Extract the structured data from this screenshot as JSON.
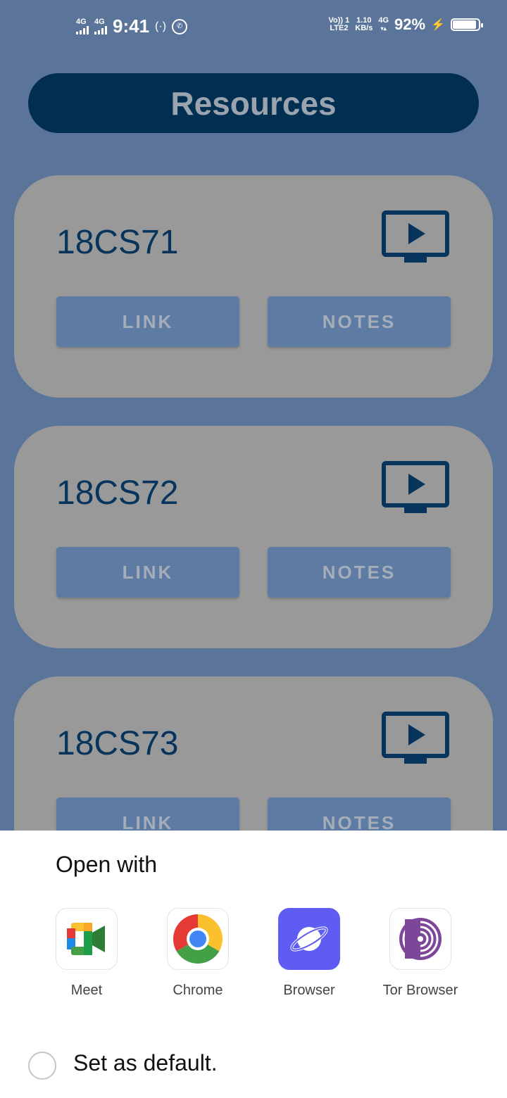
{
  "status_bar": {
    "sim1_label": "4G",
    "sim2_label": "4G",
    "time": "9:41",
    "hotspot_icon": "(·)",
    "whatsapp_icon": "✆",
    "volte_line1": "Vo)) 1",
    "volte_line2": "LTE2",
    "speed_value": "1.10",
    "speed_unit": "KB/s",
    "net_type": "4G",
    "battery_pct": "92%",
    "battery_level": 0.92,
    "charging_icon": "⚡"
  },
  "header": {
    "title": "Resources"
  },
  "cards": [
    {
      "code": "18CS71",
      "link_label": "LINK",
      "notes_label": "NOTES"
    },
    {
      "code": "18CS72",
      "link_label": "LINK",
      "notes_label": "NOTES"
    },
    {
      "code": "18CS73",
      "link_label": "LINK",
      "notes_label": "NOTES"
    }
  ],
  "colors": {
    "background": "#5a7599",
    "header": "#002f52",
    "card": "#999999",
    "button": "#5d7ba3",
    "code_text": "#06345c"
  },
  "sheet": {
    "title": "Open with",
    "apps": [
      {
        "label": "Meet",
        "icon": "meet-icon"
      },
      {
        "label": "Chrome",
        "icon": "chrome-icon"
      },
      {
        "label": "Browser",
        "icon": "browser-icon"
      },
      {
        "label": "Tor Browser",
        "icon": "tor-browser-icon"
      }
    ],
    "default_label": "Set as default."
  }
}
